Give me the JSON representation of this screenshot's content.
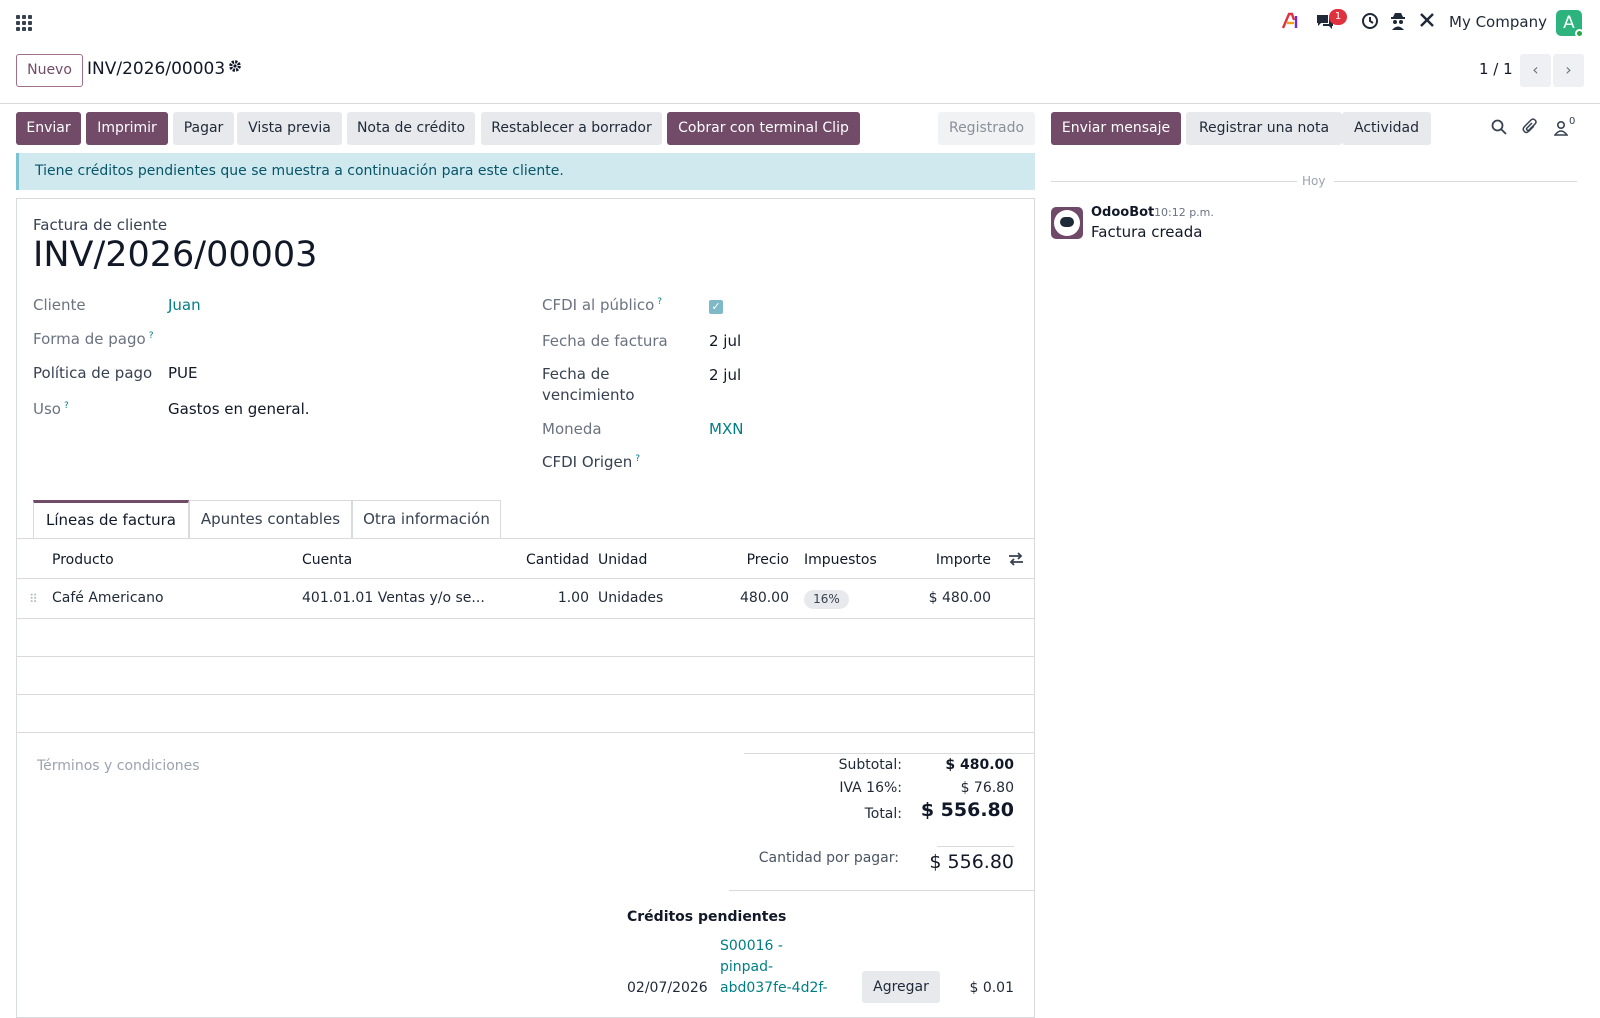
{
  "topbar": {
    "company": "My Company",
    "avatar_letter": "A",
    "messages_badge": "1",
    "icons": [
      "apps-grid-icon",
      "ai-icon",
      "messages-icon",
      "clock-icon",
      "spy-icon",
      "tools-icon"
    ]
  },
  "control": {
    "new_label": "Nuevo",
    "breadcrumb": "INV/2026/00003",
    "pager": "1 / 1"
  },
  "actions": {
    "enviar": "Enviar",
    "imprimir": "Imprimir",
    "pagar": "Pagar",
    "vista_previa": "Vista previa",
    "nota_credito": "Nota de crédito",
    "restablecer": "Restablecer a borrador",
    "cobrar": "Cobrar con terminal Clip",
    "status": "Registrado"
  },
  "alert": "Tiene créditos pendientes que se muestra a continuación para este cliente.",
  "invoice": {
    "type_label": "Factura de cliente",
    "number": "INV/2026/00003",
    "cliente_label": "Cliente",
    "cliente": "Juan",
    "forma_pago_label": "Forma de pago",
    "politica_label": "Política de pago",
    "politica": "PUE",
    "uso_label": "Uso",
    "uso": "Gastos en general.",
    "cfdi_publico_label": "CFDI al público",
    "cfdi_publico_checked": true,
    "fecha_factura_label": "Fecha de factura",
    "fecha_factura": "2 jul",
    "fecha_venc_label_1": "Fecha de",
    "fecha_venc_label_2": "vencimiento",
    "fecha_venc": "2 jul",
    "moneda_label": "Moneda",
    "moneda": "MXN",
    "cfdi_origen_label": "CFDI Origen",
    "help_mark": "?"
  },
  "tabs": [
    "Líneas de factura",
    "Apuntes contables",
    "Otra información"
  ],
  "lines": {
    "headers": [
      "Producto",
      "Cuenta",
      "Cantidad",
      "Unidad",
      "Precio",
      "Impuestos",
      "Importe"
    ],
    "rows": [
      {
        "producto": "Café Americano",
        "cuenta": "401.01.01 Ventas y/o se...",
        "cantidad": "1.00",
        "unidad": "Unidades",
        "precio": "480.00",
        "impuestos": "16%",
        "importe": "$ 480.00"
      }
    ]
  },
  "terms_placeholder": "Términos y condiciones",
  "totals": {
    "subtotal_label": "Subtotal:",
    "subtotal": "$ 480.00",
    "iva_label": "IVA 16%:",
    "iva": "$ 76.80",
    "total_label": "Total:",
    "total": "$ 556.80",
    "por_pagar_label": "Cantidad por pagar:",
    "por_pagar": "$ 556.80"
  },
  "credits": {
    "title": "Créditos pendientes",
    "date": "02/07/2026",
    "ref_1": "S00016 -",
    "ref_2": "pinpad-",
    "ref_3": "abd037fe-4d2f-",
    "add_label": "Agregar",
    "amount": "$ 0.01"
  },
  "chatter": {
    "send_message": "Enviar mensaje",
    "log_note": "Registrar una nota",
    "activity": "Actividad",
    "followers_count": "0",
    "day_label": "Hoy",
    "author": "OdooBot",
    "time": "10:12 p.m.",
    "message": "Factura creada"
  }
}
